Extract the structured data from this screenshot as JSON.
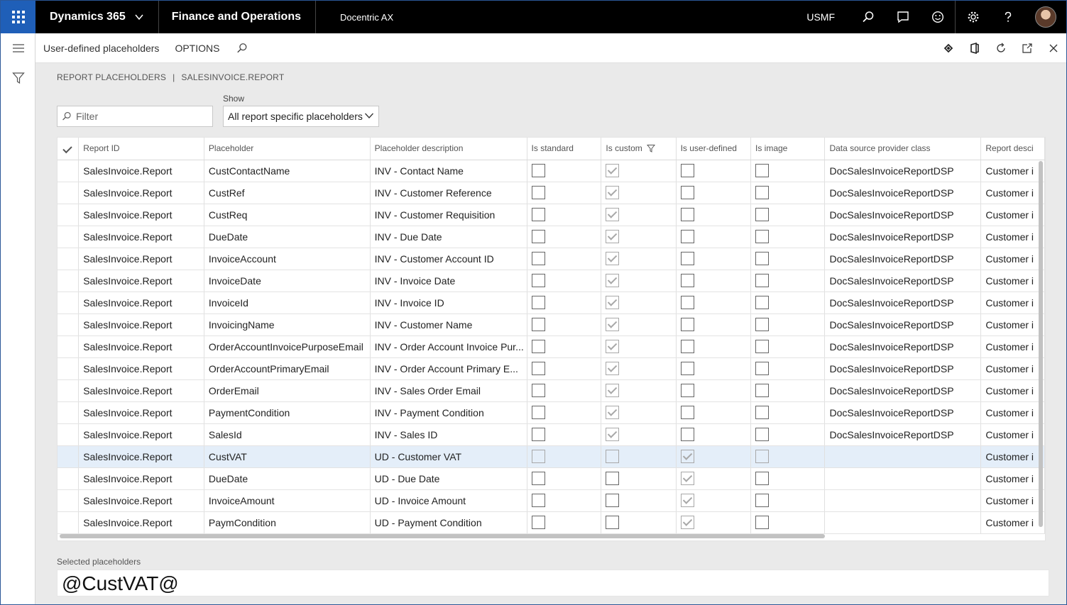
{
  "topbar": {
    "brand": "Dynamics 365",
    "module": "Finance and Operations",
    "subproduct": "Docentric AX",
    "company": "USMF"
  },
  "actionpane": {
    "title": "User-defined placeholders",
    "options": "OPTIONS"
  },
  "breadcrumb": {
    "part1": "REPORT PLACEHOLDERS",
    "separator": "|",
    "part2": "SALESINVOICE.REPORT"
  },
  "filter": {
    "placeholder": "Filter"
  },
  "show": {
    "label": "Show",
    "value": "All report specific placeholders"
  },
  "grid": {
    "headers": [
      "Report ID",
      "Placeholder",
      "Placeholder description",
      "Is standard",
      "Is custom",
      "Is user-defined",
      "Is image",
      "Data source provider class",
      "Report desci"
    ],
    "rows": [
      {
        "report_id": "SalesInvoice.Report",
        "placeholder": "CustContactName",
        "description": "INV - Contact Name",
        "is_standard": false,
        "is_custom": true,
        "is_user_defined": false,
        "is_image": false,
        "provider": "DocSalesInvoiceReportDSP",
        "report_desc": "Customer i"
      },
      {
        "report_id": "SalesInvoice.Report",
        "placeholder": "CustRef",
        "description": "INV - Customer Reference",
        "is_standard": false,
        "is_custom": true,
        "is_user_defined": false,
        "is_image": false,
        "provider": "DocSalesInvoiceReportDSP",
        "report_desc": "Customer i"
      },
      {
        "report_id": "SalesInvoice.Report",
        "placeholder": "CustReq",
        "description": "INV - Customer Requisition",
        "is_standard": false,
        "is_custom": true,
        "is_user_defined": false,
        "is_image": false,
        "provider": "DocSalesInvoiceReportDSP",
        "report_desc": "Customer i"
      },
      {
        "report_id": "SalesInvoice.Report",
        "placeholder": "DueDate",
        "description": "INV - Due Date",
        "is_standard": false,
        "is_custom": true,
        "is_user_defined": false,
        "is_image": false,
        "provider": "DocSalesInvoiceReportDSP",
        "report_desc": "Customer i"
      },
      {
        "report_id": "SalesInvoice.Report",
        "placeholder": "InvoiceAccount",
        "description": "INV - Customer Account ID",
        "is_standard": false,
        "is_custom": true,
        "is_user_defined": false,
        "is_image": false,
        "provider": "DocSalesInvoiceReportDSP",
        "report_desc": "Customer i"
      },
      {
        "report_id": "SalesInvoice.Report",
        "placeholder": "InvoiceDate",
        "description": "INV - Invoice Date",
        "is_standard": false,
        "is_custom": true,
        "is_user_defined": false,
        "is_image": false,
        "provider": "DocSalesInvoiceReportDSP",
        "report_desc": "Customer i"
      },
      {
        "report_id": "SalesInvoice.Report",
        "placeholder": "InvoiceId",
        "description": "INV - Invoice ID",
        "is_standard": false,
        "is_custom": true,
        "is_user_defined": false,
        "is_image": false,
        "provider": "DocSalesInvoiceReportDSP",
        "report_desc": "Customer i"
      },
      {
        "report_id": "SalesInvoice.Report",
        "placeholder": "InvoicingName",
        "description": "INV - Customer Name",
        "is_standard": false,
        "is_custom": true,
        "is_user_defined": false,
        "is_image": false,
        "provider": "DocSalesInvoiceReportDSP",
        "report_desc": "Customer i"
      },
      {
        "report_id": "SalesInvoice.Report",
        "placeholder": "OrderAccountInvoicePurposeEmail",
        "description": "INV - Order Account Invoice Pur...",
        "is_standard": false,
        "is_custom": true,
        "is_user_defined": false,
        "is_image": false,
        "provider": "DocSalesInvoiceReportDSP",
        "report_desc": "Customer i"
      },
      {
        "report_id": "SalesInvoice.Report",
        "placeholder": "OrderAccountPrimaryEmail",
        "description": "INV - Order Account Primary E...",
        "is_standard": false,
        "is_custom": true,
        "is_user_defined": false,
        "is_image": false,
        "provider": "DocSalesInvoiceReportDSP",
        "report_desc": "Customer i"
      },
      {
        "report_id": "SalesInvoice.Report",
        "placeholder": "OrderEmail",
        "description": "INV - Sales Order Email",
        "is_standard": false,
        "is_custom": true,
        "is_user_defined": false,
        "is_image": false,
        "provider": "DocSalesInvoiceReportDSP",
        "report_desc": "Customer i"
      },
      {
        "report_id": "SalesInvoice.Report",
        "placeholder": "PaymentCondition",
        "description": "INV - Payment Condition",
        "is_standard": false,
        "is_custom": true,
        "is_user_defined": false,
        "is_image": false,
        "provider": "DocSalesInvoiceReportDSP",
        "report_desc": "Customer i"
      },
      {
        "report_id": "SalesInvoice.Report",
        "placeholder": "SalesId",
        "description": "INV - Sales ID",
        "is_standard": false,
        "is_custom": true,
        "is_user_defined": false,
        "is_image": false,
        "provider": "DocSalesInvoiceReportDSP",
        "report_desc": "Customer i"
      },
      {
        "report_id": "SalesInvoice.Report",
        "placeholder": "CustVAT",
        "description": "UD - Customer VAT",
        "is_standard": false,
        "is_custom": false,
        "is_user_defined": true,
        "is_image": false,
        "provider": "",
        "report_desc": "Customer i",
        "selected": true
      },
      {
        "report_id": "SalesInvoice.Report",
        "placeholder": "DueDate",
        "description": "UD - Due Date",
        "is_standard": false,
        "is_custom": false,
        "is_user_defined": true,
        "is_image": false,
        "provider": "",
        "report_desc": "Customer i"
      },
      {
        "report_id": "SalesInvoice.Report",
        "placeholder": "InvoiceAmount",
        "description": "UD - Invoice Amount",
        "is_standard": false,
        "is_custom": false,
        "is_user_defined": true,
        "is_image": false,
        "provider": "",
        "report_desc": "Customer i"
      },
      {
        "report_id": "SalesInvoice.Report",
        "placeholder": "PaymCondition",
        "description": "UD - Payment Condition",
        "is_standard": false,
        "is_custom": false,
        "is_user_defined": true,
        "is_image": false,
        "provider": "",
        "report_desc": "Customer i"
      }
    ]
  },
  "selected_placeholders": {
    "label": "Selected placeholders",
    "value": "@CustVAT@"
  },
  "colors": {
    "topbar": "#000000",
    "waffle": "#1f5fb8",
    "selected_row": "#e4eef9",
    "frame_border": "#2b5797"
  },
  "icons": [
    "app-launcher-icon",
    "chevron-down-icon",
    "search-icon",
    "message-icon",
    "smiley-icon",
    "gear-icon",
    "help-icon",
    "hamburger-icon",
    "filter-icon",
    "diamond-icon",
    "office-icon",
    "refresh-icon",
    "popout-icon",
    "close-icon"
  ]
}
